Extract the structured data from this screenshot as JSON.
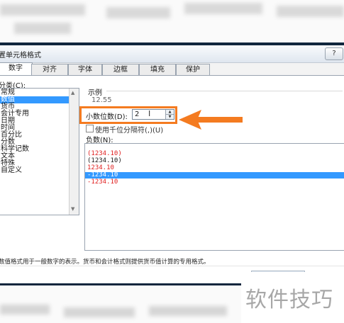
{
  "dialog": {
    "title": "置单元格格式",
    "help_label": "?"
  },
  "tabs": [
    {
      "label": "数字"
    },
    {
      "label": "对齐"
    },
    {
      "label": "字体"
    },
    {
      "label": "边框"
    },
    {
      "label": "填充"
    },
    {
      "label": "保护"
    }
  ],
  "category": {
    "label": "分类(C):",
    "items": [
      "常规",
      "数值",
      "货币",
      "会计专用",
      "日期",
      "时间",
      "百分比",
      "分数",
      "科学记数",
      "文本",
      "特殊",
      "自定义"
    ],
    "selected_index": 1
  },
  "example": {
    "label": "示例",
    "value": "12.55"
  },
  "decimal": {
    "label": "小数位数(D):",
    "value": "2"
  },
  "thousands": {
    "label": "使用千位分隔符(,)(U)",
    "checked": false
  },
  "negative": {
    "label": "负数(N):",
    "items": [
      "(1234.10)",
      "(1234.10)",
      "1234.10",
      "-1234.10",
      "-1234.10"
    ],
    "red_indices": [
      0,
      2,
      4
    ],
    "selected_index": 3
  },
  "description": "数值格式用于一般数字的表示。货币和会计格式则提供货币值计算的专用格式。",
  "watermark": "软件技巧",
  "colors": {
    "accent_orange": "#f47b20",
    "selection_blue": "#3399ff",
    "negative_red": "#e02020",
    "frame_dark": "#10263d"
  }
}
